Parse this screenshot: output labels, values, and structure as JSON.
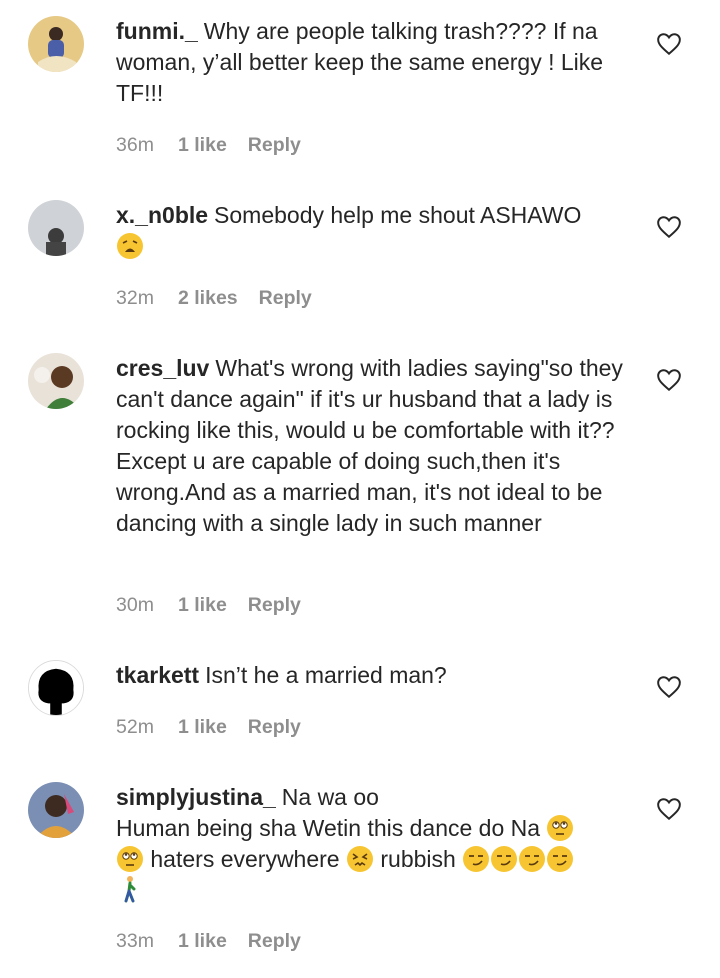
{
  "comments": [
    {
      "username": "funmi._",
      "text": "Why are people talking trash???? If na woman, y’all better keep the same energy ! Like TF!!!",
      "time": "36m",
      "likes": "1 like",
      "reply": "Reply",
      "avatar_icon": "user-avatar-photo"
    },
    {
      "username": "x._n0ble",
      "text": "Somebody help me shout ASHAWO",
      "emoji_after": [
        "weary-face-emoji"
      ],
      "time": "32m",
      "likes": "2 likes",
      "reply": "Reply",
      "avatar_icon": "user-avatar-photo"
    },
    {
      "username": "cres_luv",
      "text": "What's wrong with ladies saying\"so they can't dance again\" if it's ur husband that a lady is rocking like this, would u be comfortable with it?? Except u are capable of doing such,then it's wrong.And as a married man, it's not ideal to be dancing with a single lady in such manner",
      "time": "30m",
      "likes": "1 like",
      "reply": "Reply",
      "avatar_icon": "user-avatar-photo"
    },
    {
      "username": "tkarkett",
      "text": "Isn’t he a married man?",
      "time": "52m",
      "likes": "1 like",
      "reply": "Reply",
      "avatar_icon": "user-avatar-silhouette"
    },
    {
      "username": "simplyjustina_",
      "text_line1": "Na wa oo",
      "text_line2": "Human being sha Wetin this dance do Na",
      "text_line3a": "haters everywhere",
      "text_line3b": "rubbish",
      "emojis": [
        "face-with-rolling-eyes-emoji",
        "confounded-face-emoji",
        "smirking-face-emoji",
        "person-walking-emoji"
      ],
      "time": "33m",
      "likes": "1 like",
      "reply": "Reply",
      "avatar_icon": "user-avatar-photo"
    }
  ],
  "icons": {
    "like": "heart-outline-icon"
  },
  "colors": {
    "text": "#262626",
    "meta": "#8e8e8e",
    "emoji": "#f7c531"
  }
}
